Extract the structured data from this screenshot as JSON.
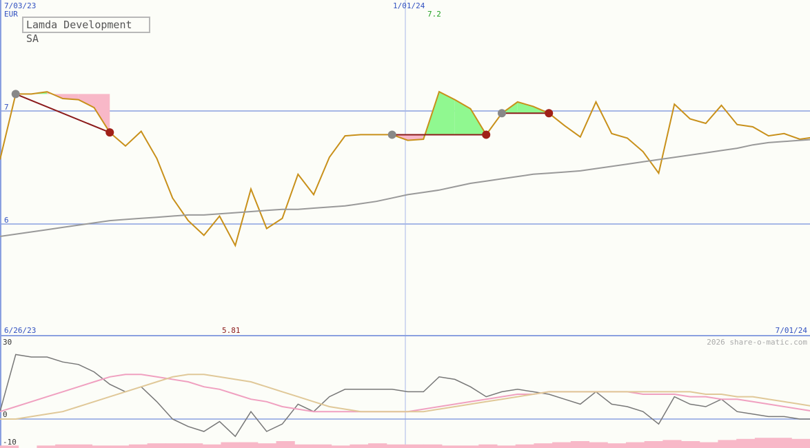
{
  "title": "Lamda Development SA",
  "chart_data": [
    {
      "type": "line",
      "currency": "EUR",
      "date_labels_top": [
        "7/03/23",
        "1/01/24"
      ],
      "date_labels_bottom": [
        "6/26/23",
        "7/01/24"
      ],
      "y_ticks": [
        7,
        6
      ],
      "ylim": [
        5.0,
        7.4
      ],
      "max_label": "7.2",
      "min_label": "5.81",
      "grid": true,
      "series": [
        {
          "color": "#c8901a",
          "values": [
            6.57,
            7.15,
            7.15,
            7.17,
            7.11,
            7.1,
            7.03,
            6.81,
            6.69,
            6.82,
            6.58,
            6.23,
            6.03,
            5.9,
            6.07,
            5.81,
            6.31,
            5.96,
            6.05,
            6.44,
            6.26,
            6.59,
            6.78,
            6.79,
            6.79,
            6.79,
            6.74,
            6.75,
            7.17,
            7.1,
            7.02,
            6.79,
            6.98,
            7.08,
            7.04,
            6.98,
            6.87,
            6.77,
            7.08,
            6.8,
            6.76,
            6.64,
            6.45,
            7.06,
            6.93,
            6.89,
            7.05,
            6.88,
            6.86,
            6.78,
            6.8,
            6.75,
            6.77
          ]
        },
        {
          "color": "#999999",
          "values": [
            5.89,
            5.91,
            5.93,
            5.95,
            5.97,
            5.99,
            6.01,
            6.03,
            6.04,
            6.05,
            6.06,
            6.07,
            6.08,
            6.08,
            6.09,
            6.1,
            6.11,
            6.12,
            6.13,
            6.13,
            6.14,
            6.15,
            6.16,
            6.18,
            6.2,
            6.23,
            6.26,
            6.28,
            6.3,
            6.33,
            6.36,
            6.38,
            6.4,
            6.42,
            6.44,
            6.45,
            6.46,
            6.47,
            6.49,
            6.51,
            6.53,
            6.55,
            6.57,
            6.59,
            6.61,
            6.63,
            6.65,
            6.67,
            6.7,
            6.72,
            6.73,
            6.74,
            6.75
          ]
        }
      ],
      "trades": [
        {
          "start_index": 1,
          "end_index": 7,
          "start_value": 7.15,
          "end_value": 6.81
        },
        {
          "start_index": 25,
          "end_index": 31,
          "start_value": 6.79,
          "end_value": 6.79
        },
        {
          "start_index": 32,
          "end_index": 35,
          "start_value": 6.98,
          "end_value": 6.98
        }
      ],
      "trade_colors": {
        "line": "#8b1a1a",
        "start_marker": "#888888",
        "end_marker": "#a02018",
        "gain_fill": "#90f890",
        "loss_fill": "#f8b8c8"
      }
    },
    {
      "type": "line",
      "y_ticks": [
        30,
        0,
        -10
      ],
      "ylim": [
        -10,
        33
      ],
      "watermark": "2026 share-o-matic.com",
      "series": [
        {
          "color": "#777777",
          "values": [
            3,
            26,
            25,
            25,
            23,
            22,
            19,
            14,
            11,
            13,
            7,
            0,
            -3,
            -5,
            -1,
            -7,
            3,
            -5,
            -2,
            6,
            3,
            9,
            12,
            12,
            12,
            12,
            11,
            11,
            17,
            16,
            13,
            9,
            11,
            12,
            11,
            10,
            8,
            6,
            11,
            6,
            5,
            3,
            -2,
            9,
            6,
            5,
            8,
            3,
            2,
            1,
            1,
            0,
            0
          ]
        },
        {
          "color": "#f0a0c0",
          "values": [
            3,
            5,
            7,
            9,
            11,
            13,
            15,
            17,
            18,
            18,
            17,
            16,
            15,
            13,
            12,
            10,
            8,
            7,
            5,
            4,
            3,
            3,
            3,
            3,
            3,
            3,
            3,
            4,
            5,
            6,
            7,
            8,
            9,
            10,
            10,
            11,
            11,
            11,
            11,
            11,
            11,
            10,
            10,
            10,
            9,
            9,
            8,
            8,
            7,
            6,
            5,
            4,
            3
          ]
        },
        {
          "color": "#e0c898",
          "values": [
            0,
            0,
            1,
            2,
            3,
            5,
            7,
            9,
            11,
            13,
            15,
            17,
            18,
            18,
            17,
            16,
            15,
            13,
            11,
            9,
            7,
            5,
            4,
            3,
            3,
            3,
            3,
            3,
            4,
            5,
            6,
            7,
            8,
            9,
            10,
            11,
            11,
            11,
            11,
            11,
            11,
            11,
            11,
            11,
            11,
            10,
            10,
            9,
            9,
            8,
            7,
            6,
            5
          ]
        }
      ],
      "volume_bars": [
        1,
        0,
        1,
        2,
        2,
        1,
        1,
        2,
        3,
        3,
        3,
        2,
        4,
        4,
        3,
        5,
        2,
        2,
        1,
        2,
        3,
        2,
        2,
        2,
        1,
        1,
        2,
        1,
        2,
        3,
        4,
        5,
        4,
        3,
        4,
        5,
        6,
        5,
        4,
        6,
        7,
        8,
        8,
        7
      ],
      "volume_highlight": [
        1
      ]
    }
  ]
}
